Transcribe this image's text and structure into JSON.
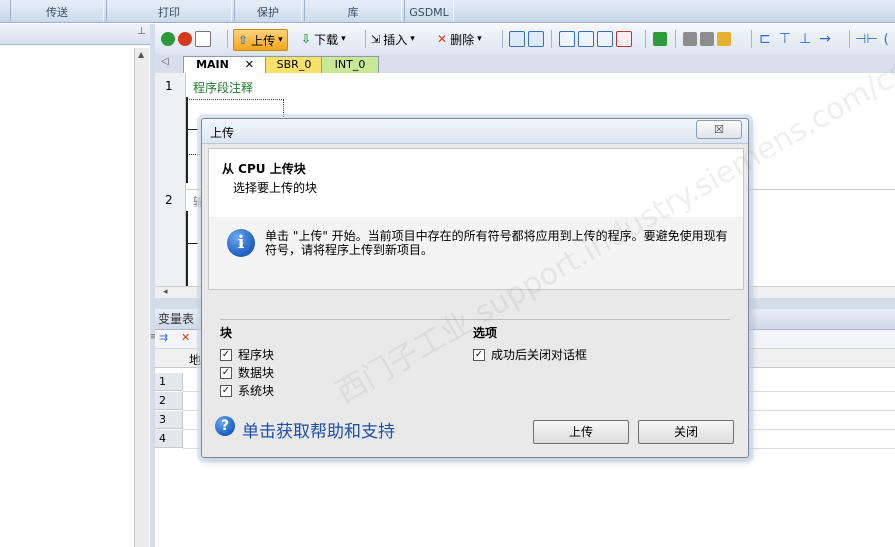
{
  "ribbon": {
    "groups": [
      "传送",
      "打印",
      "保护",
      "库",
      "GSDML"
    ]
  },
  "toolbar": {
    "upload_label": "上传",
    "download_label": "下载",
    "insert_label": "插入",
    "delete_label": "删除"
  },
  "tabs": [
    {
      "label": "MAIN"
    },
    {
      "label": "SBR_0"
    },
    {
      "label": "INT_0"
    }
  ],
  "editor": {
    "networks": [
      {
        "number": "1",
        "comment": "程序段注释"
      },
      {
        "number": "2",
        "comment": "输"
      }
    ]
  },
  "var_table": {
    "title": "变量表",
    "column_address": "地",
    "rows": [
      "1",
      "2",
      "3",
      "4"
    ]
  },
  "dialog": {
    "title": "上传",
    "close_label": "☒",
    "heading": "从 CPU 上传块",
    "subheading": "选择要上传的块",
    "info_text": "单击 \"上传\" 开始。当前项目中存在的所有符号都将应用到上传的程序。要避免使用现有符号，请将程序上传到新项目。",
    "blocks": {
      "title": "块",
      "items": [
        {
          "label": "程序块",
          "checked": "✓"
        },
        {
          "label": "数据块",
          "checked": "✓"
        },
        {
          "label": "系统块",
          "checked": "✓"
        }
      ]
    },
    "options": {
      "title": "选项",
      "items": [
        {
          "label": "成功后关闭对话框",
          "checked": "✓"
        }
      ]
    },
    "help_link": "单击获取帮助和支持",
    "upload_button": "上传",
    "close_button": "关闭"
  },
  "watermark": "西门子工业 support.industry.siemens.com/cs  技术论坛"
}
